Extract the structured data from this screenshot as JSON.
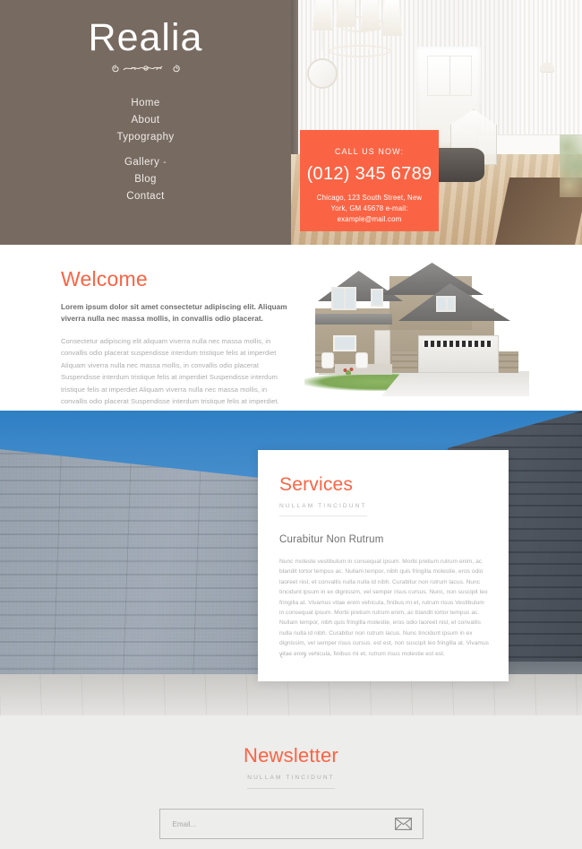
{
  "header": {
    "logo": "Realia",
    "ornament_icon": "flourish-divider-icon",
    "nav": [
      {
        "label": "Home",
        "id": "home"
      },
      {
        "label": "About",
        "id": "about"
      },
      {
        "label": "Typography",
        "id": "typography"
      },
      {
        "label": "Gallery",
        "id": "gallery",
        "caret": "-"
      },
      {
        "label": "Blog",
        "id": "blog"
      },
      {
        "label": "Contact",
        "id": "contact"
      }
    ],
    "background_color": "#776a61"
  },
  "call_box": {
    "label": "CALL US NOW:",
    "phone": "(012) 345 6789",
    "address": "Chicago, 123 South Street, New York, GM 45678 e-mail: example@mail.com",
    "background_color": "#fa6445"
  },
  "welcome": {
    "title": "Welcome",
    "lead": "Lorem ipsum dolor sit amet consectetur adipiscing elit. Aliquam viverra nulla nec massa mollis, in convallis odio placerat.",
    "body": "Consectetur adipiscing elit aliquam viverra nulla nec massa mollis, in convallis odio placerat suspendisse interdum tristique felis at imperdiet Aliquam viverra nulla nec massa mollis, in convallis odio placerat Suspendisse interdum tristique felis at imperdiet Suspendisse interdum tristique felis at imperdiet Aliquam viverra nulla nec massa mollis, in convallis odio placerat Suspendisse interdum tristique felis at imperdiet.",
    "image_name": "suburban-house-photo"
  },
  "services": {
    "title": "Services",
    "subtitle": "NULLAM TINCIDUNT",
    "heading": "Curabitur Non Rutrum",
    "body": "Nunc moleste vestibulum in consequat ipsum. Morbi pretium rutrum enim, ac blandit tortor tempus ac. Nullam tempor, nibh quis fringilla molestie, eros odio laoreet nisl, et convallis nulla nulla id nibh. Curabitur non rutrum lacus. Nunc tincidunt ipsum in ex dignissim, vel semper risus cursus. Nunc, non suscipit leo fringilla at. Vivamus vitae enim vehicula, finibus mi et, rutrum risus Vestibulum in consequat ipsum. Morbi pretium rutrum enim, ac blandit tortor tempus ac. Nullam tempor, nibh quis fringilla molestie, eros odio laoreet nisl, et convallis nulla nulla id nibh. Curabitur non rutrum lacus. Nunc tincidunt ipsum in ex dignissim, vel semper risus cursus. est est, non suscipit leo fringilla at. Vivamus vitae enim vehicula, finibus mi et, rutrum risus molestie est est.",
    "prev_icon": "chevron-left-icon",
    "next_icon": "chevron-right-icon",
    "prev_glyph": "‹",
    "next_glyph": "›",
    "background_image_name": "perforated-concrete-wall-photo"
  },
  "newsletter": {
    "title": "Newsletter",
    "subtitle": "NULLAM TINCIDUNT",
    "placeholder": "Email...",
    "value": "",
    "submit_icon": "envelope-icon",
    "background_color": "#ededeb"
  },
  "theme": {
    "accent": "#fa6445",
    "header_bg": "#776a61",
    "muted_text": "#b0b0b0"
  }
}
